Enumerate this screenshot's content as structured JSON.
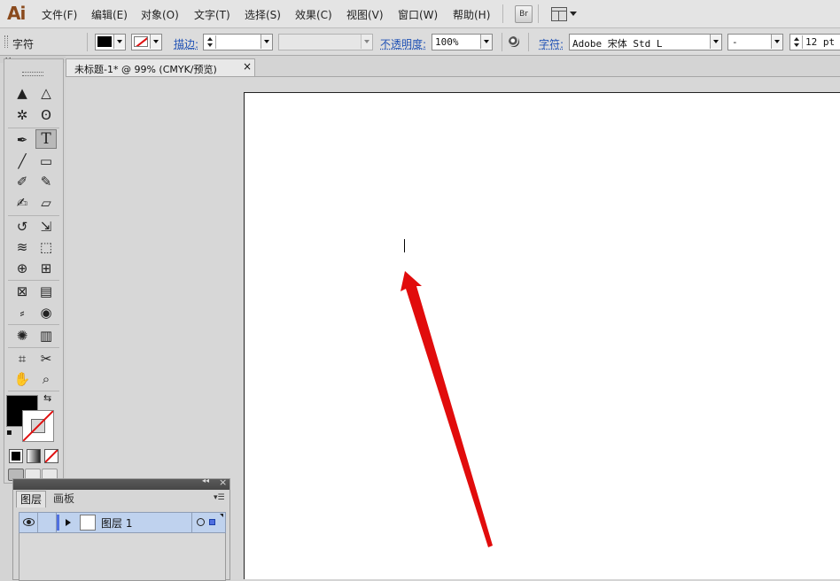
{
  "app": {
    "logo": "Ai"
  },
  "menu": [
    "文件(F)",
    "编辑(E)",
    "对象(O)",
    "文字(T)",
    "选择(S)",
    "效果(C)",
    "视图(V)",
    "窗口(W)",
    "帮助(H)"
  ],
  "toolbar": {
    "bridge_label": "Br"
  },
  "control_bar": {
    "tool_name": "字符",
    "stroke_label": "描边:",
    "opacity_label": "不透明度:",
    "opacity_value": "100%",
    "character_label": "字符:",
    "font_family": "Adobe 宋体 Std L",
    "font_style": "-",
    "font_size": "12 pt"
  },
  "document": {
    "tab_title": "未标题-1* @ 99% (CMYK/预览)",
    "close_glyph": "×"
  },
  "layers_panel": {
    "collapse_glyph": "◂◂",
    "close_glyph": "×",
    "tabs": [
      "图层",
      "画板"
    ],
    "layers": [
      {
        "name": "图层 1"
      }
    ]
  },
  "tools": {
    "selection": "▲",
    "direct_selection": "△",
    "magic_wand": "✲",
    "lasso": "ʘ",
    "pen": "✒",
    "type": "T",
    "line": "╱",
    "rectangle": "▭",
    "paintbrush": "✐",
    "pencil": "✎",
    "blob_brush": "✍",
    "eraser": "▱",
    "rotate": "↺",
    "scale": "⇲",
    "warp": "≋",
    "free_transform": "⬚",
    "shape_builder": "⊕",
    "perspective_grid": "⊞",
    "mesh": "⊠",
    "gradient": "▤",
    "eyedropper": "⸗",
    "blend": "◉",
    "symbol_sprayer": "✺",
    "column_graph": "▥",
    "artboard": "⌗",
    "slice": "✂",
    "hand": "✋",
    "zoom": "⌕",
    "swap": "⇆",
    "default": "▪"
  },
  "colors": {
    "accent_link": "#1f51b5",
    "fill": "#000000",
    "stroke_none": "#e01010",
    "annotation_arrow": "#e10c0c",
    "layer_highlight": "#bfd2ee",
    "layer_color_bar": "#4f6fe0"
  }
}
